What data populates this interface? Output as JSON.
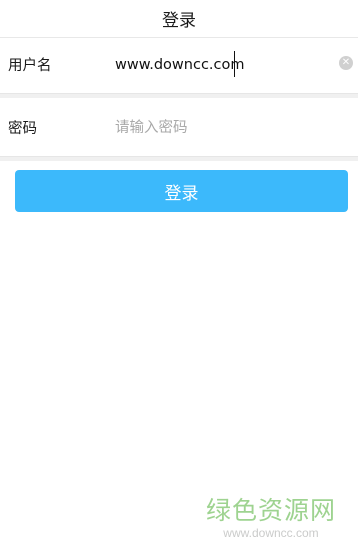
{
  "header": {
    "title": "登录"
  },
  "form": {
    "username": {
      "label": "用户名",
      "value": "www.downcc.com"
    },
    "password": {
      "label": "密码",
      "placeholder": "请输入密码",
      "value": ""
    }
  },
  "icons": {
    "clear": "clear-icon"
  },
  "buttons": {
    "login_label": "登录",
    "login_color": "#3cb9fb"
  },
  "watermark": {
    "site_name": "绿色资源网",
    "url": "www.downcc.com"
  }
}
